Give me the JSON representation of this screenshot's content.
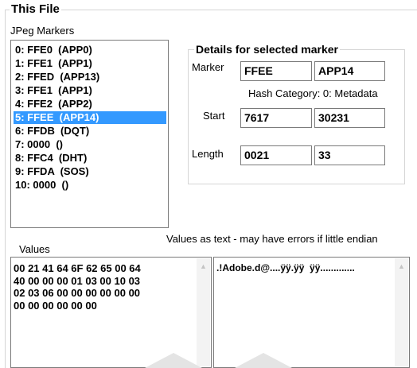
{
  "group": {
    "title": "This File"
  },
  "markers": {
    "label": "JPeg Markers",
    "items": [
      "0: FFE0  (APP0)",
      "1: FFE1  (APP1)",
      "2: FFED  (APP13)",
      "3: FFE1  (APP1)",
      "4: FFE2  (APP2)",
      "5: FFEE  (APP14)",
      "6: FFDB  (DQT)",
      "7: 0000  ()",
      "8: FFC4  (DHT)",
      "9: FFDA  (SOS)",
      "10: 0000  ()"
    ],
    "selected_index": 5
  },
  "details": {
    "title": "Details for selected marker",
    "marker_label": "Marker",
    "marker_hex": "FFEE",
    "marker_name": "APP14",
    "hash_category": "Hash Category: 0: Metadata",
    "start_label": "Start",
    "start_hex": "7617",
    "start_dec": "30231",
    "length_label": "Length",
    "length_hex": "0021",
    "length_dec": "33"
  },
  "values": {
    "label": "Values",
    "text_label": "Values as text - may have errors if little endian",
    "hex": "00 21 41 64 6F 62 65 00 64\n40 00 00 00 01 03 00 10 03\n02 03 06 00 00 00 00 00 00\n00 00 00 00 00 00",
    "text": ".!Adobe.d@....ÿÿ.ÿÿ  ÿÿ............."
  },
  "colors": {
    "selection": "#3399ff",
    "border": "#7a7a7a",
    "group_line": "#d5d5d5"
  }
}
